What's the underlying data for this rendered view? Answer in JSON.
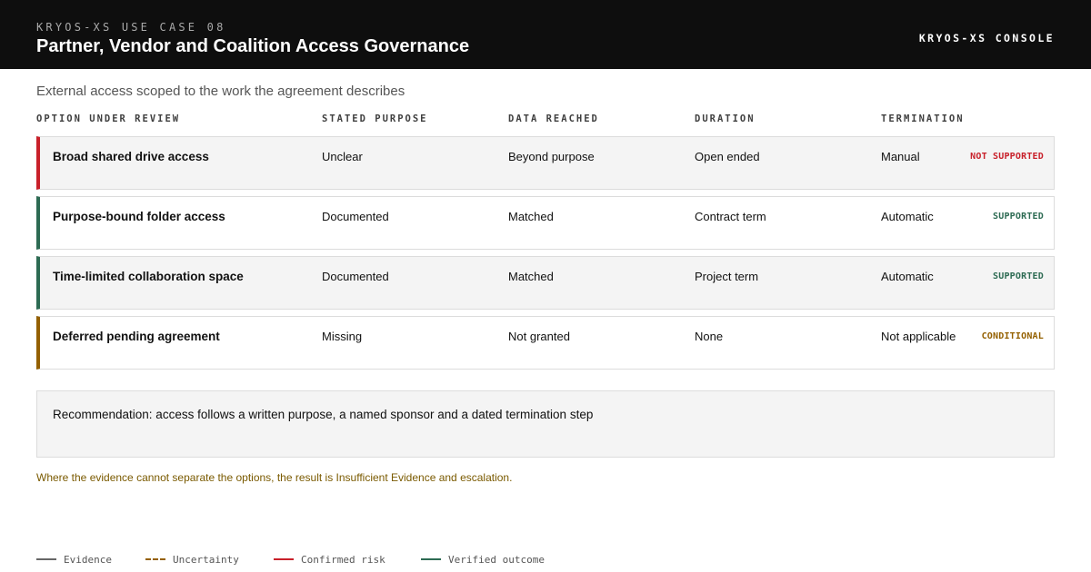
{
  "header": {
    "eyebrow": "KRYOS-XS USE CASE 08",
    "title": "Partner, Vendor and Coalition Access Governance",
    "console_label": "KRYOS-XS CONSOLE"
  },
  "subtitle": "External access scoped to the work the agreement describes",
  "table": {
    "columns": [
      "OPTION UNDER REVIEW",
      "STATED PURPOSE",
      "DATA REACHED",
      "DURATION",
      "TERMINATION"
    ],
    "rows": [
      {
        "option": "Broad shared drive access",
        "purpose": "Unclear",
        "data": "Beyond purpose",
        "duration": "Open ended",
        "termination": "Manual",
        "status": "NOT SUPPORTED",
        "status_color": "#c8202a"
      },
      {
        "option": "Purpose-bound folder access",
        "purpose": "Documented",
        "data": "Matched",
        "duration": "Contract term",
        "termination": "Automatic",
        "status": "SUPPORTED",
        "status_color": "#2d6b53"
      },
      {
        "option": "Time-limited collaboration space",
        "purpose": "Documented",
        "data": "Matched",
        "duration": "Project term",
        "termination": "Automatic",
        "status": "SUPPORTED",
        "status_color": "#2d6b53"
      },
      {
        "option": "Deferred pending agreement",
        "purpose": "Missing",
        "data": "Not granted",
        "duration": "None",
        "termination": "Not applicable",
        "status": "CONDITIONAL",
        "status_color": "#946000"
      }
    ]
  },
  "recommendation": "Recommendation: access follows a written purpose, a named sponsor and a dated termination step",
  "note": "Where the evidence cannot separate the options, the result is Insufficient Evidence and escalation.",
  "legend": [
    {
      "label": "Evidence",
      "color": "#666666",
      "style": "solid"
    },
    {
      "label": "Uncertainty",
      "color": "#946000",
      "style": "dashed"
    },
    {
      "label": "Confirmed risk",
      "color": "#c8202a",
      "style": "solid"
    },
    {
      "label": "Verified outcome",
      "color": "#2d6b53",
      "style": "solid"
    }
  ]
}
